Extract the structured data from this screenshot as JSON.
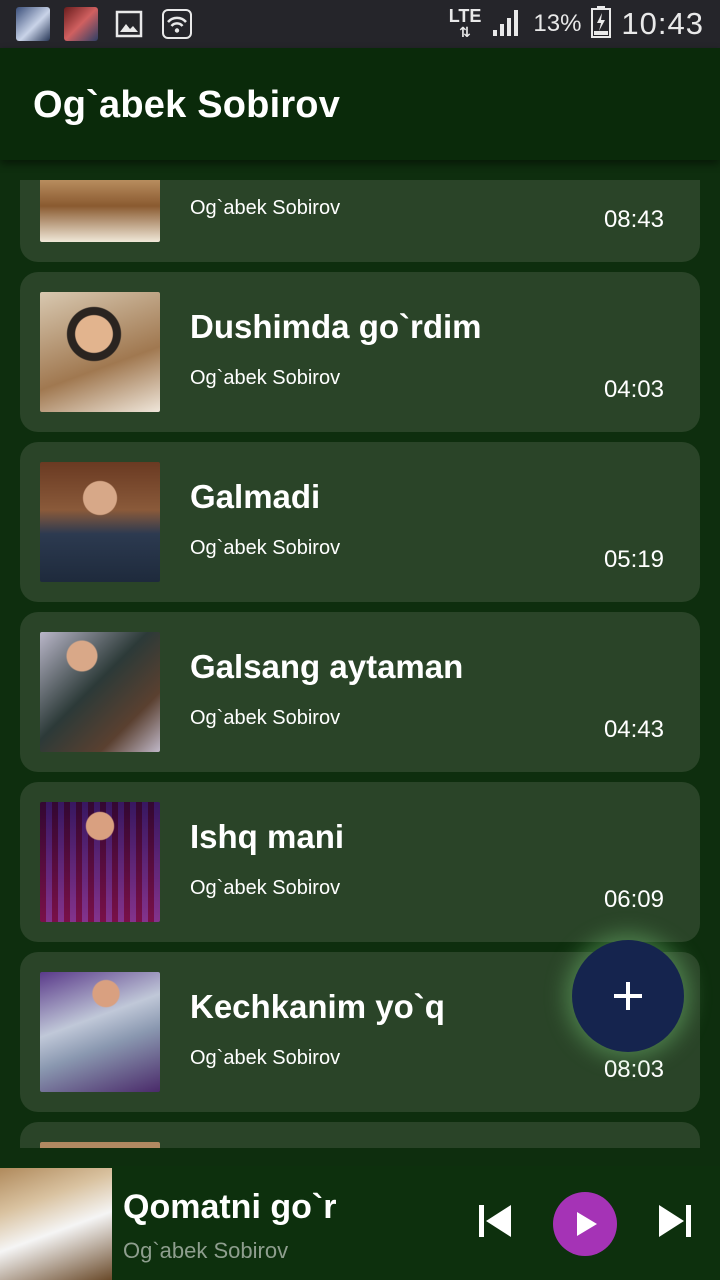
{
  "status_bar": {
    "network": "LTE",
    "battery": "13%",
    "time": "10:43"
  },
  "app_bar": {
    "title": "Og`abek Sobirov"
  },
  "tracks": [
    {
      "title": "",
      "artist": "Og`abek Sobirov",
      "duration": "08:43"
    },
    {
      "title": "Dushimda go`rdim",
      "artist": "Og`abek Sobirov",
      "duration": "04:03"
    },
    {
      "title": "Galmadi",
      "artist": "Og`abek Sobirov",
      "duration": "05:19"
    },
    {
      "title": "Galsang aytaman",
      "artist": "Og`abek Sobirov",
      "duration": "04:43"
    },
    {
      "title": "Ishq mani",
      "artist": "Og`abek Sobirov",
      "duration": "06:09"
    },
    {
      "title": "Kechkanim yo`q",
      "artist": "Og`abek Sobirov",
      "duration": "08:03"
    },
    {
      "title": "",
      "artist": "",
      "duration": ""
    }
  ],
  "fab": {
    "icon": "plus-icon"
  },
  "player": {
    "title": "Qomatni go`r",
    "artist": "Og`abek Sobirov",
    "controls": [
      "skip-previous-icon",
      "play-icon",
      "skip-next-icon"
    ],
    "play_color": "#a533b6"
  }
}
